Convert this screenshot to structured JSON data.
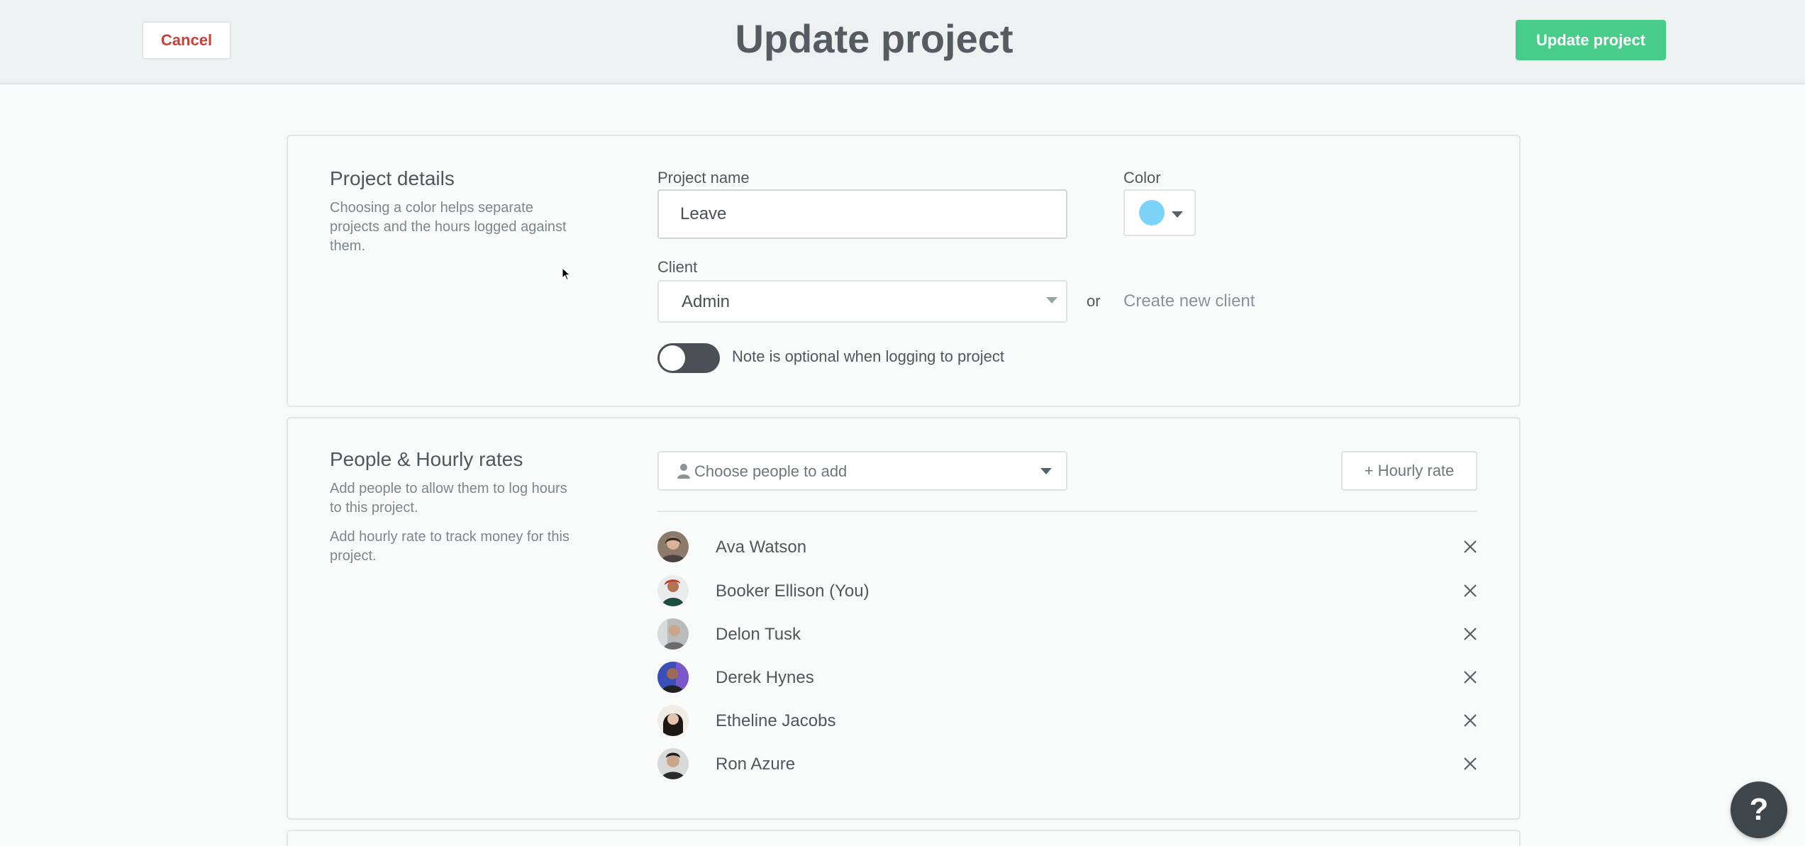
{
  "header": {
    "cancel_label": "Cancel",
    "title": "Update project",
    "update_label": "Update project"
  },
  "project_details": {
    "title": "Project details",
    "description": "Choosing a color helps separate projects and the hours logged against them.",
    "name_label": "Project name",
    "name_value": "Leave",
    "color_label": "Color",
    "color_value": "#7dd3f7",
    "client_label": "Client",
    "client_value": "Admin",
    "or_text": "or",
    "create_client_label": "Create new client",
    "note_toggle_label": "Note is optional when logging to project",
    "note_toggle_on": true
  },
  "people": {
    "title": "People & Hourly rates",
    "description_1": "Add people to allow them to log hours to this project.",
    "description_2": "Add hourly rate to track money for this project.",
    "choose_placeholder": "Choose people to add",
    "hourly_rate_label": "+ Hourly rate",
    "members": [
      {
        "name": "Ava Watson"
      },
      {
        "name": "Booker Ellison (You)"
      },
      {
        "name": "Delon Tusk"
      },
      {
        "name": "Derek Hynes"
      },
      {
        "name": "Etheline Jacobs"
      },
      {
        "name": "Ron Azure"
      }
    ]
  },
  "help": {
    "label": "?"
  },
  "colors": {
    "accent_green": "#47cc8a",
    "cancel_red": "#c9403a",
    "toggle_dark": "#4a5055"
  }
}
